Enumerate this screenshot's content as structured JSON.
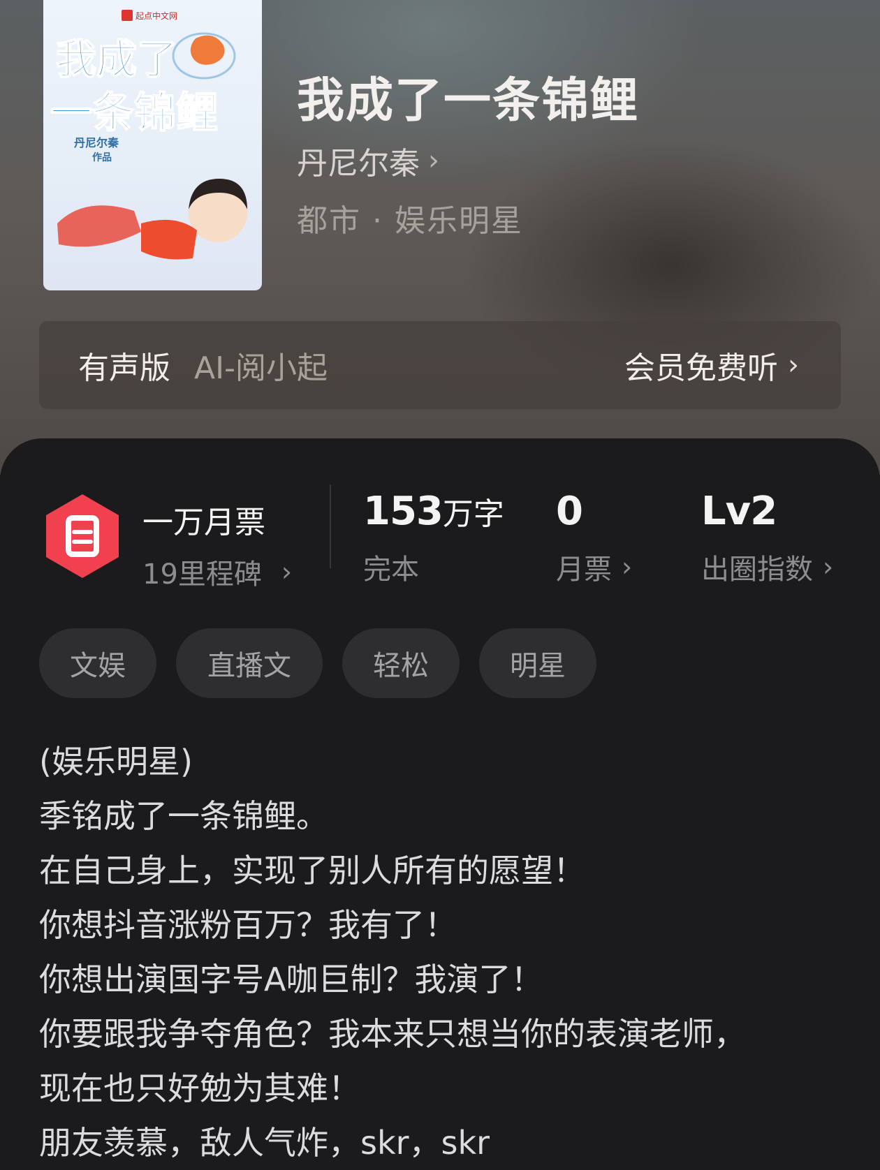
{
  "cover": {
    "publisher": "起点中文网",
    "art_title_line1": "我成了",
    "art_title_line2": "一条锦鲤",
    "art_author": "丹尼尔秦",
    "art_author_suffix": "作品"
  },
  "book": {
    "title": "我成了一条锦鲤",
    "author": "丹尼尔秦",
    "genre": "都市 · 娱乐明星"
  },
  "audio": {
    "label": "有声版",
    "narrator": "AI-阅小起",
    "action": "会员免费听"
  },
  "stats": {
    "ticket_title": "一万月票",
    "ticket_sub": "19里程碑",
    "words_value": "153",
    "words_unit": "万字",
    "status": "完本",
    "monthly_votes": "0",
    "monthly_votes_label": "月票",
    "level": "Lv2",
    "level_label": "出圈指数"
  },
  "tags": [
    "文娱",
    "直播文",
    "轻松",
    "明星"
  ],
  "description": [
    "(娱乐明星)",
    "季铭成了一条锦鲤。",
    "在自己身上，实现了别人所有的愿望！",
    "你想抖音涨粉百万？我有了！",
    "你想出演国字号A咖巨制？我演了！",
    "你要跟我争夺角色？我本来只想当你的表演老师，",
    "现在也只好勉为其难！",
    "朋友羡慕，敌人气炸，skr，skr"
  ],
  "colors": {
    "panel_bg": "#1b1b1d",
    "tag_bg": "#2e2e31",
    "ticket_red": "#f2414e"
  },
  "icons": {
    "author_chevron": "chevron-right-icon",
    "ticket": "ticket-icon"
  }
}
